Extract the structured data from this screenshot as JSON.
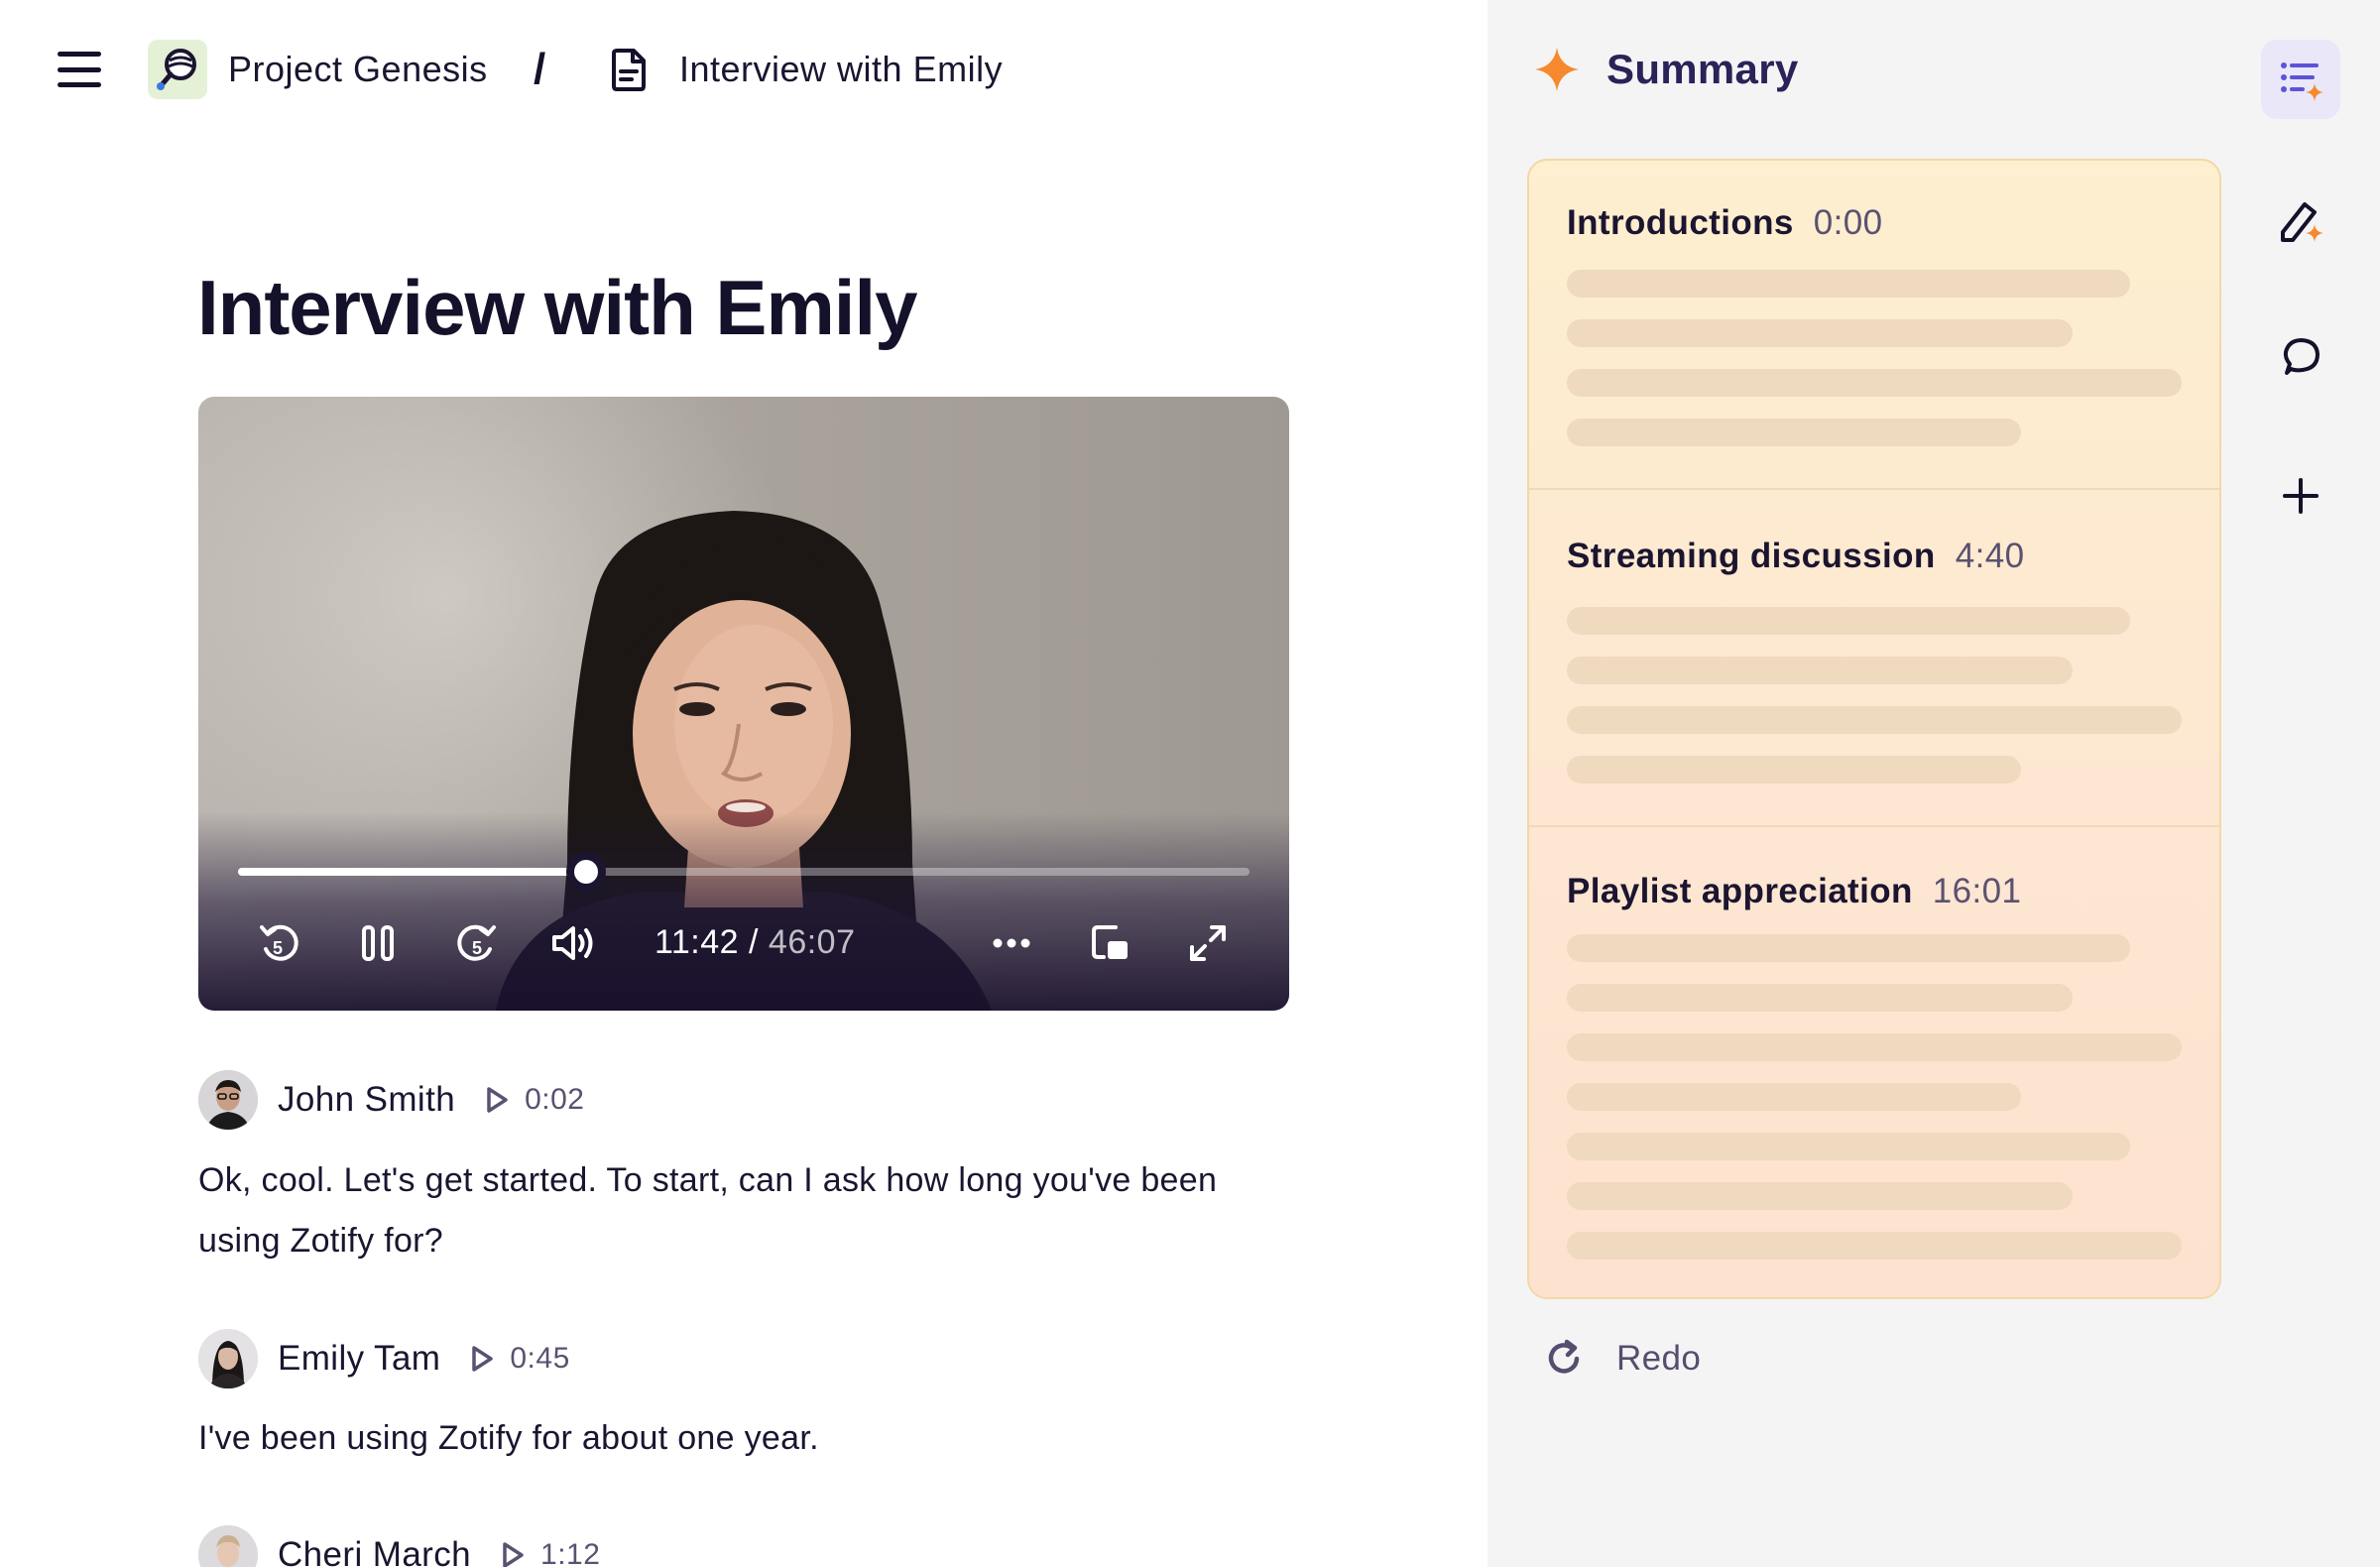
{
  "breadcrumb": {
    "project_name": "Project Genesis",
    "separator": "/",
    "document_name": "Interview with Emily"
  },
  "page": {
    "title": "Interview with Emily"
  },
  "video": {
    "current_time": "11:42",
    "time_separator": " / ",
    "total_time": "46:07",
    "progress_fraction": 0.3437
  },
  "transcript": [
    {
      "speaker": "John Smith",
      "timestamp": "0:02",
      "text": "Ok, cool. Let's get started. To start, can I ask how long you've been using Zotify for?"
    },
    {
      "speaker": "Emily Tam",
      "timestamp": "0:45",
      "text": "I've been using Zotify for about one year."
    },
    {
      "speaker": "Cheri March",
      "timestamp": "1:12",
      "text": ""
    }
  ],
  "summary": {
    "title": "Summary",
    "sections": [
      {
        "heading": "Introductions",
        "time": "0:00"
      },
      {
        "heading": "Streaming discussion",
        "time": "4:40"
      },
      {
        "heading": "Playlist appreciation",
        "time": "16:01"
      }
    ],
    "redo_label": "Redo"
  },
  "colors": {
    "accent_orange": "#f6892d",
    "summary_title": "#2a2358",
    "rail_active": "#5b54d6"
  },
  "icons": [
    "menu-icon",
    "project-logo-icon",
    "document-icon",
    "rewind-5-icon",
    "pause-icon",
    "forward-5-icon",
    "volume-icon",
    "more-icon",
    "picture-in-picture-icon",
    "fullscreen-icon",
    "play-icon",
    "sparkle-icon",
    "summary-list-icon",
    "edit-magic-icon",
    "comment-icon",
    "plus-icon",
    "redo-icon"
  ]
}
